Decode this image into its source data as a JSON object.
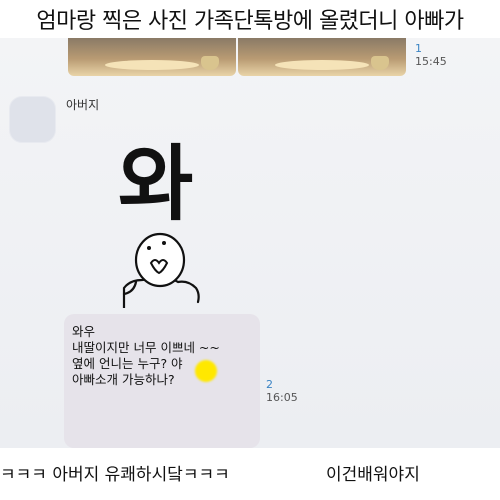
{
  "caption_top": "엄마랑 찍은 사진 가족단톡방에 올렸더니 아빠가",
  "chat": {
    "photo_message": {
      "unread_count": "1",
      "time": "15:45"
    },
    "sender_name": "아버지",
    "sticker": {
      "text": "와"
    },
    "text_message": {
      "text": "와우\n내딸이지만  너무 이쁘네 ~~\n옆에 언니는 누구?     야\n아빠소개 가능하나?",
      "unread_count": "2",
      "time": "16:05"
    }
  },
  "caption_bottom": {
    "left": "ㅋㅋㅋ 아버지 유쾌하시닼ㅋㅋㅋ",
    "right": "이건배워야지"
  }
}
